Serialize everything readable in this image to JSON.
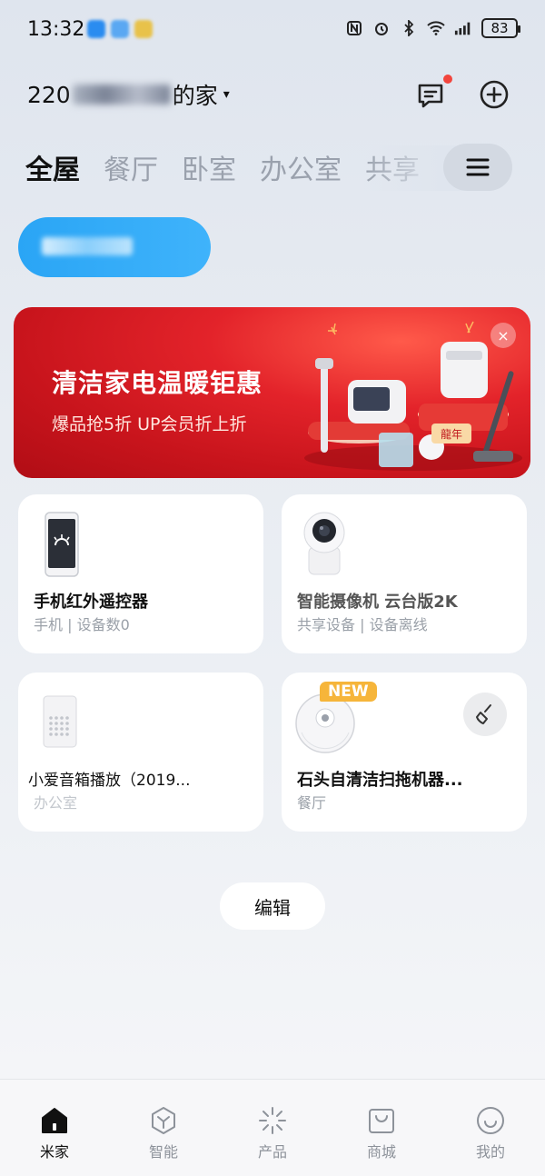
{
  "status_bar": {
    "time": "13:32",
    "battery": "83"
  },
  "header": {
    "home_name_prefix": "220",
    "home_name_suffix": "的家",
    "caret": "▾"
  },
  "room_tabs": [
    "全屋",
    "餐厅",
    "卧室",
    "办公室",
    "共享"
  ],
  "banner": {
    "title": "清洁家电温暖钜惠",
    "subtitle": "爆品抢5折 UP会员折上折",
    "close": "×"
  },
  "devices": [
    {
      "name": "手机红外遥控器",
      "status": "手机 | 设备数0"
    },
    {
      "name": "智能摄像机 云台版2K",
      "status": "共享设备 | 设备离线"
    },
    {
      "name": "小爱音箱播放（2019...",
      "status": "办公室"
    },
    {
      "name": "石头自清洁扫拖机器...",
      "status": "餐厅",
      "badge": "NEW"
    }
  ],
  "edit_label": "编辑",
  "nav": [
    {
      "label": "米家",
      "icon": "home-icon"
    },
    {
      "label": "智能",
      "icon": "smart-icon"
    },
    {
      "label": "产品",
      "icon": "product-icon"
    },
    {
      "label": "商城",
      "icon": "shop-icon"
    },
    {
      "label": "我的",
      "icon": "profile-icon"
    }
  ],
  "colors": {
    "accent_blue": "#2aa5f5",
    "banner_red": "#d81e26",
    "badge_orange": "#f6b53a",
    "notification_red": "#f2453d"
  }
}
